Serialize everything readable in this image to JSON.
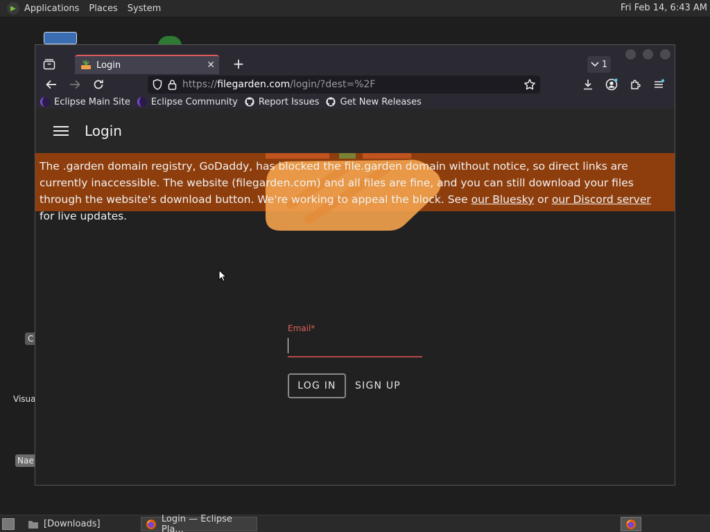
{
  "top_panel": {
    "menus": [
      "Applications",
      "Places",
      "System"
    ],
    "clock": "Fri Feb 14,  6:43 AM"
  },
  "desktop": {
    "label_c": "C",
    "label_visua": "Visua",
    "label_nae": "Nae"
  },
  "browser": {
    "tab": {
      "title": "Login"
    },
    "tab_count": "1",
    "url": {
      "scheme": "https://",
      "host": "filegarden.com",
      "path": "/login/?dest=%2F"
    },
    "bookmarks": [
      {
        "label": "Eclipse Main Site",
        "icon": "eclipse-icon"
      },
      {
        "label": "Eclipse Community",
        "icon": "eclipse-icon"
      },
      {
        "label": "Report Issues",
        "icon": "github-icon"
      },
      {
        "label": "Get New Releases",
        "icon": "github-icon"
      }
    ]
  },
  "page": {
    "title": "Login",
    "banner": {
      "text_1": "The .garden domain registry, GoDaddy, has blocked the file.garden domain without notice, so direct links are currently inaccessible. The website (filegarden.com) and all files are fine, and you can still download your files through the website's download button. We're working to appeal the block. See ",
      "link_bluesky": "our Bluesky",
      "text_2": " or ",
      "link_discord": "our Discord server",
      "text_3": " for live updates."
    },
    "form": {
      "email_label": "Email",
      "required_mark": "*",
      "email_value": "",
      "login_label": "LOG IN",
      "signup_label": "SIGN UP"
    }
  },
  "taskbar": {
    "items": [
      {
        "label": "[Downloads]"
      },
      {
        "label": "Login — Eclipse Pla..."
      }
    ]
  },
  "colors": {
    "banner_bg": "#8e3e0d",
    "accent_error": "#e0605a",
    "tab_accent": "#e05b5b"
  }
}
